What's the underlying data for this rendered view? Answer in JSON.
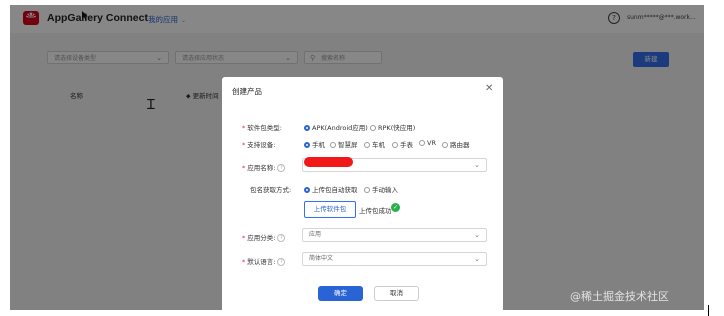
{
  "header": {
    "app_name": "AppGallery Connect",
    "app_switcher": "我的应用",
    "account": "sunm*****@***.work...",
    "brand_color": "#d8001b"
  },
  "filters": {
    "filter1_placeholder": "请选择设备类型",
    "filter2_placeholder": "请选择应用状态",
    "search_placeholder": "搜索名称",
    "new_button": "新建"
  },
  "table": {
    "col_name": "名称",
    "col_updated": "更新时间"
  },
  "modal": {
    "title": "创建产品",
    "package_type": {
      "label": "软件包类型:",
      "options": [
        "APK(Android应用)",
        "RPK(快应用)"
      ],
      "selected": "APK(Android应用)"
    },
    "devices": {
      "label": "支持设备:",
      "options": [
        "手机",
        "智慧屏",
        "车机",
        "手表",
        "VR",
        "路由器"
      ],
      "selected": "手机"
    },
    "app_name": {
      "label": "应用名称:",
      "value": "[redacted]"
    },
    "package_name_method": {
      "label": "包名获取方式:",
      "options": [
        "上传包自动获取",
        "手动输入"
      ],
      "selected": "上传包自动获取"
    },
    "upload": {
      "button": "上传软件包",
      "status": "上传包成功"
    },
    "category": {
      "label": "应用分类:",
      "value": "应用"
    },
    "language": {
      "label": "默认语言:",
      "value": "简体中文"
    },
    "confirm_button": "确定",
    "cancel_button": "取消",
    "accent_color": "#2a63d3"
  },
  "watermark": "@稀土掘金技术社区"
}
